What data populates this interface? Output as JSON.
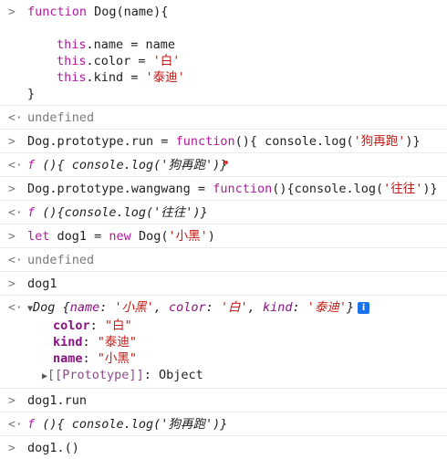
{
  "prompt_glyph": ">",
  "return_glyph": "<·",
  "entries": [
    {
      "code": [
        "function Dog(name){",
        "",
        "this.name = name",
        "this.color = '白'",
        "this.kind = '泰迪'",
        "}"
      ],
      "result": "undefined"
    },
    {
      "code_a": "Dog.prototype.run = ",
      "code_b": "function",
      "code_c": "(){ console.log(",
      "code_str": "'狗再跑'",
      "code_d": ")}",
      "result_f": "f",
      "result_body": " (){ console.log('狗再跑')}"
    },
    {
      "code_a": "Dog.prototype.wangwang = ",
      "code_b": "function",
      "code_c": "(){console.log(",
      "code_str": "'往往'",
      "code_d": ")}",
      "result_f": "f",
      "result_body": " (){console.log('往往')}"
    },
    {
      "code_let": "let",
      "code_a": " dog1 = ",
      "code_new": "new",
      "code_b": " Dog(",
      "code_str": "'小黑'",
      "code_c": ")",
      "result": "undefined"
    },
    {
      "code": "dog1",
      "obj_class": "Dog",
      "obj_preview_open": " {",
      "obj_props": [
        {
          "k": "name",
          "v": "'小黑'"
        },
        {
          "k": "color",
          "v": "'白'"
        },
        {
          "k": "kind",
          "v": "'泰迪'"
        }
      ],
      "obj_preview_close": "}",
      "info": "i",
      "props": [
        {
          "k": "color",
          "v": "\"白\""
        },
        {
          "k": "kind",
          "v": "\"泰迪\""
        },
        {
          "k": "name",
          "v": "\"小黑\""
        }
      ],
      "proto_label": "[[Prototype]]",
      "proto_value": ": Object"
    },
    {
      "code": "dog1.run",
      "result_f": "f",
      "result_body": " (){ console.log('狗再跑')}"
    },
    {
      "code": "dog1.()"
    }
  ]
}
